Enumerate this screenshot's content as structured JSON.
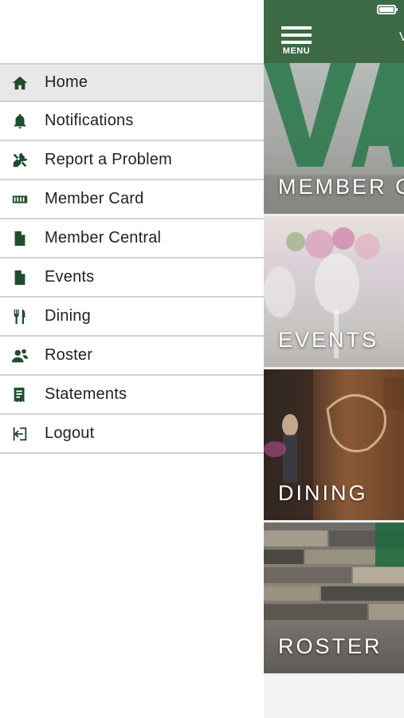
{
  "drawer": {
    "items": [
      {
        "label": "Home",
        "icon": "home-icon",
        "active": true
      },
      {
        "label": "Notifications",
        "icon": "bell-icon",
        "active": false
      },
      {
        "label": "Report a Problem",
        "icon": "tools-icon",
        "active": false
      },
      {
        "label": "Member Card",
        "icon": "card-icon",
        "active": false
      },
      {
        "label": "Member Central",
        "icon": "document-icon",
        "active": false
      },
      {
        "label": "Events",
        "icon": "document-icon",
        "active": false
      },
      {
        "label": "Dining",
        "icon": "utensils-icon",
        "active": false
      },
      {
        "label": "Roster",
        "icon": "people-icon",
        "active": false
      },
      {
        "label": "Statements",
        "icon": "statement-icon",
        "active": false
      },
      {
        "label": "Logout",
        "icon": "logout-icon",
        "active": false
      }
    ]
  },
  "main": {
    "menu_label": "MENU",
    "title_partial": "V",
    "tiles": [
      {
        "label": "MEMBER C"
      },
      {
        "label": "EVENTS"
      },
      {
        "label": "DINING"
      },
      {
        "label": "ROSTER"
      }
    ]
  },
  "colors": {
    "brand_green": "#3c6a45",
    "icon_green": "#1f4d2e",
    "active_row": "#e8e8e8"
  }
}
